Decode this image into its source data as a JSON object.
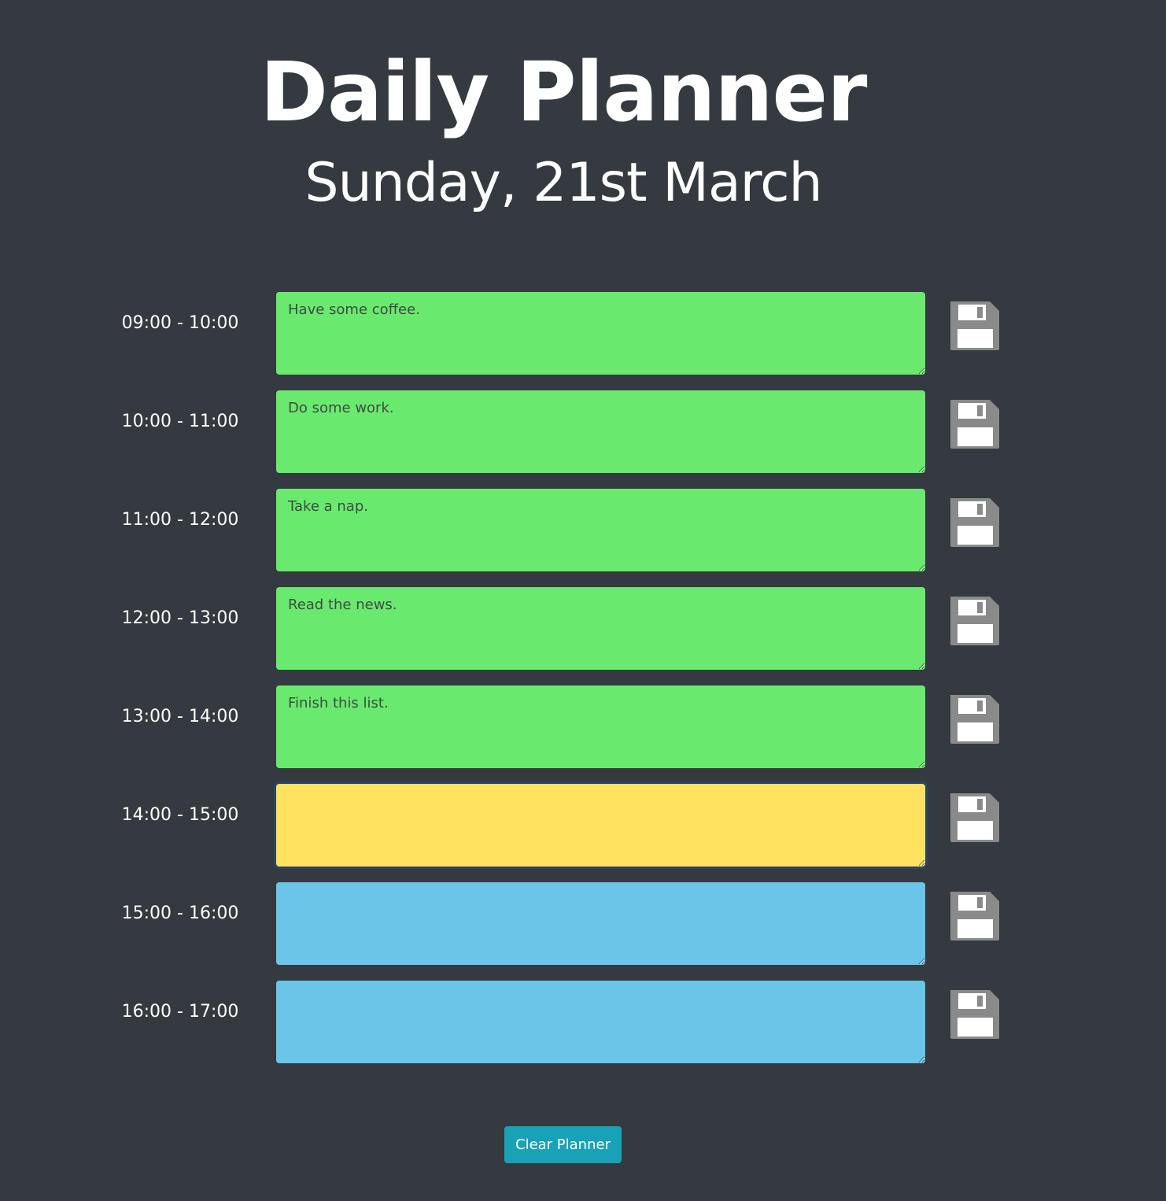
{
  "header": {
    "title": "Daily Planner",
    "date": "Sunday, 21st March"
  },
  "rows": [
    {
      "hour": "09:00 - 10:00",
      "text": "Have some coffee.",
      "status": "past"
    },
    {
      "hour": "10:00 - 11:00",
      "text": "Do some work.",
      "status": "past"
    },
    {
      "hour": "11:00 - 12:00",
      "text": "Take a nap.",
      "status": "past"
    },
    {
      "hour": "12:00 - 13:00",
      "text": "Read the news.",
      "status": "past"
    },
    {
      "hour": "13:00 - 14:00",
      "text": "Finish this list.",
      "status": "past"
    },
    {
      "hour": "14:00 - 15:00",
      "text": "",
      "status": "present"
    },
    {
      "hour": "15:00 - 16:00",
      "text": "",
      "status": "future"
    },
    {
      "hour": "16:00 - 17:00",
      "text": "",
      "status": "future"
    }
  ],
  "icons": {
    "save": "floppy-disk-icon"
  },
  "colors": {
    "background": "#343a40",
    "past": "#69ea6e",
    "present": "#ffe25f",
    "future": "#6ac5e9",
    "save_icon": "#8a8a8a",
    "clear_button": "#17a2b8"
  },
  "footer": {
    "clear_label": "Clear Planner"
  }
}
